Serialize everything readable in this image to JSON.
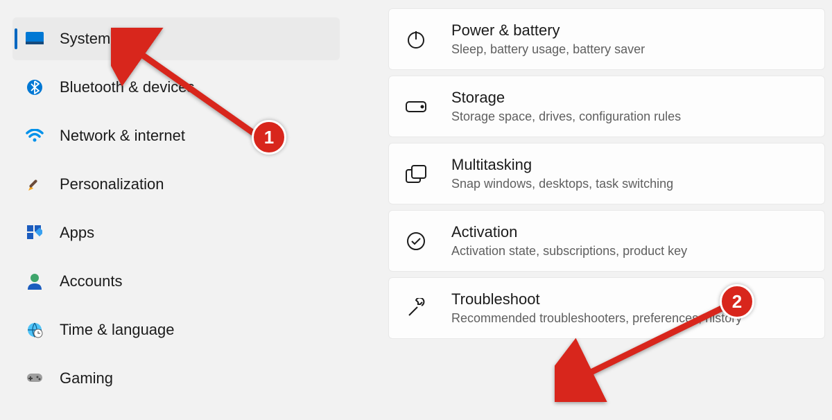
{
  "sidebar": {
    "items": [
      {
        "label": "System",
        "active": true
      },
      {
        "label": "Bluetooth & devices",
        "active": false
      },
      {
        "label": "Network & internet",
        "active": false
      },
      {
        "label": "Personalization",
        "active": false
      },
      {
        "label": "Apps",
        "active": false
      },
      {
        "label": "Accounts",
        "active": false
      },
      {
        "label": "Time & language",
        "active": false
      },
      {
        "label": "Gaming",
        "active": false
      }
    ]
  },
  "main": {
    "cards": [
      {
        "title": "Power & battery",
        "subtitle": "Sleep, battery usage, battery saver"
      },
      {
        "title": "Storage",
        "subtitle": "Storage space, drives, configuration rules"
      },
      {
        "title": "Multitasking",
        "subtitle": "Snap windows, desktops, task switching"
      },
      {
        "title": "Activation",
        "subtitle": "Activation state, subscriptions, product key"
      },
      {
        "title": "Troubleshoot",
        "subtitle": "Recommended troubleshooters, preferences, history"
      }
    ]
  },
  "annotations": {
    "badge1": "1",
    "badge2": "2"
  }
}
